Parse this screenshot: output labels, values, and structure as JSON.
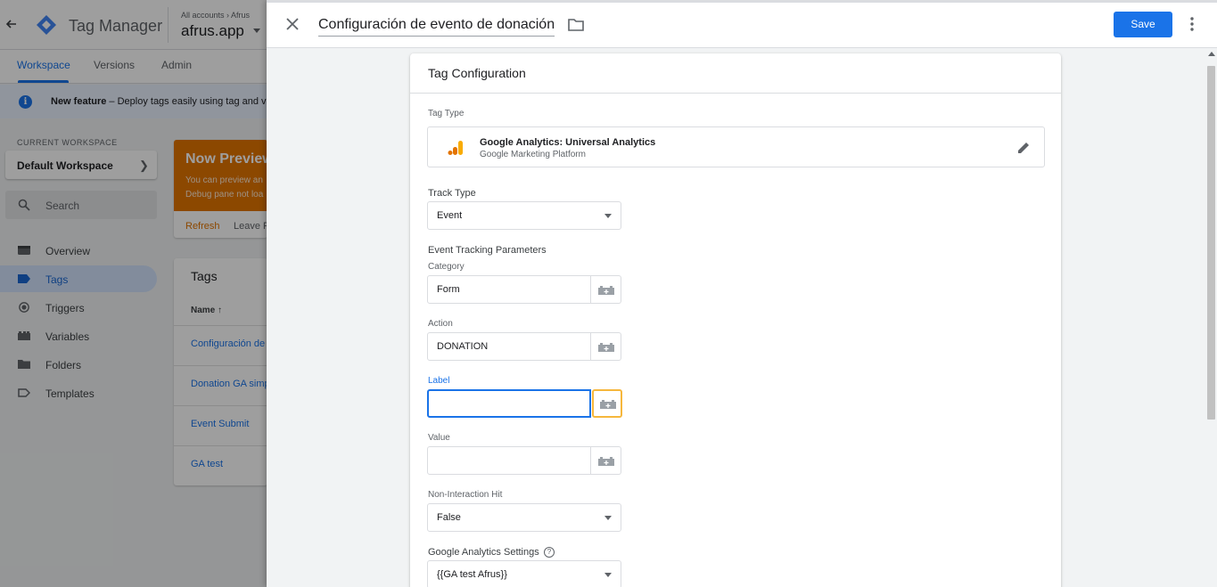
{
  "app": {
    "title": "Tag Manager",
    "breadcrumb": "All accounts › Afrus",
    "container": "afrus.app"
  },
  "nav_tabs": [
    "Workspace",
    "Versions",
    "Admin"
  ],
  "notice": {
    "bold": "New feature",
    "text": " – Deploy tags easily using tag and var"
  },
  "sidebar": {
    "workspace_label": "CURRENT WORKSPACE",
    "workspace_name": "Default Workspace",
    "search_placeholder": "Search",
    "items": [
      {
        "label": "Overview",
        "icon": "overview-icon"
      },
      {
        "label": "Tags",
        "icon": "tag-icon",
        "active": true
      },
      {
        "label": "Triggers",
        "icon": "trigger-icon"
      },
      {
        "label": "Variables",
        "icon": "variables-icon"
      },
      {
        "label": "Folders",
        "icon": "folder-icon"
      },
      {
        "label": "Templates",
        "icon": "templates-icon"
      }
    ]
  },
  "preview": {
    "title": "Now Preview",
    "line1": "You can preview an",
    "line2": "Debug pane not loa",
    "refresh": "Refresh",
    "leave": "Leave P"
  },
  "tags_list": {
    "title": "Tags",
    "column": "Name ↑",
    "rows": [
      "Configuración de",
      "Donation GA simp",
      "Event Submit",
      "GA test"
    ]
  },
  "panel": {
    "tag_name": "Configuración de evento de donación",
    "save_label": "Save"
  },
  "config": {
    "card_title": "Tag Configuration",
    "tag_type_label": "Tag Type",
    "tag_type_name": "Google Analytics: Universal Analytics",
    "tag_type_sub": "Google Marketing Platform",
    "track_type_label": "Track Type",
    "track_type_value": "Event",
    "params_label": "Event Tracking Parameters",
    "category_label": "Category",
    "category_value": "Form",
    "action_label": "Action",
    "action_value": "DONATION",
    "label_label": "Label",
    "label_value": "",
    "value_label": "Value",
    "value_value": "",
    "nih_label": "Non-Interaction Hit",
    "nih_value": "False",
    "ga_settings_label": "Google Analytics Settings",
    "ga_settings_value": "{{GA test Afrus}}"
  },
  "colors": {
    "accent": "#1a73e8",
    "preview_orange": "#e37400",
    "highlight": "#f6b73c"
  }
}
